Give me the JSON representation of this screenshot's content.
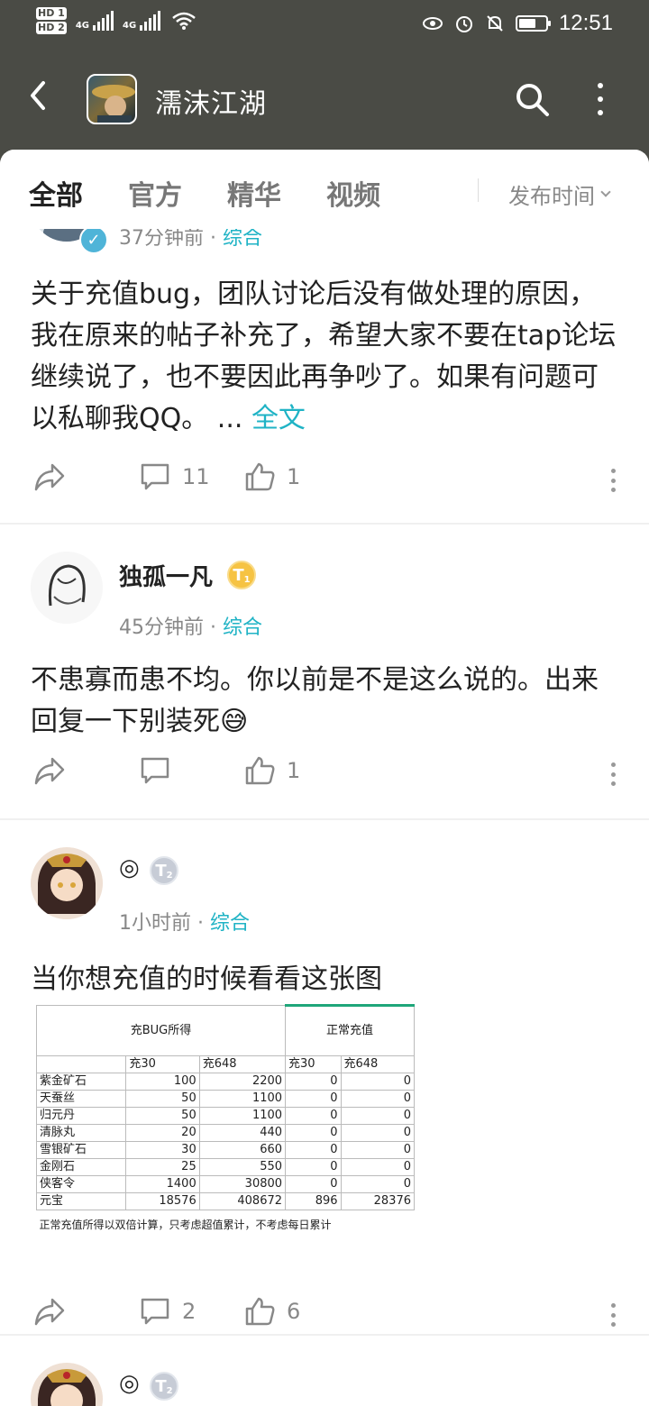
{
  "status": {
    "hd1": "HD 1",
    "hd2": "HD 2",
    "net1": "4G",
    "net2": "4G",
    "time": "12:51"
  },
  "header": {
    "title": "濡沫江湖"
  },
  "tabs": [
    "全部",
    "官方",
    "精华",
    "视频"
  ],
  "sort_label": "发布时间",
  "colors": {
    "accent": "#1fb3c5",
    "header_bg": "#4a4b45"
  },
  "posts": [
    {
      "meta_time": "37分钟前",
      "category": "综合",
      "body": "关于充值bug，团队讨论后没有做处理的原因，我在原来的帖子补充了，希望大家不要在tap论坛继续说了，也不要因此再争吵了。如果有问题可以私聊我QQ。",
      "ellipsis": "...",
      "more": "全文",
      "comments": "11",
      "likes": "1"
    },
    {
      "author": "独孤一凡",
      "badge": "T",
      "badge_level": "1",
      "meta_time": "45分钟前",
      "category": "综合",
      "body": "不患寡而患不均。你以前是不是这么说的。出来回复一下别装死😅",
      "comments": "",
      "likes": "1"
    },
    {
      "author": "◎",
      "badge": "T",
      "badge_level": "2",
      "meta_time": "1小时前",
      "category": "综合",
      "body": "当你想充值的时候看看这张图",
      "comments": "2",
      "likes": "6",
      "table": {
        "group_bug": "充BUG所得",
        "group_normal": "正常充值",
        "sub_headers": [
          "充30",
          "充648",
          "充30",
          "充648"
        ],
        "rows": [
          [
            "紫金矿石",
            "100",
            "2200",
            "0",
            "0"
          ],
          [
            "天蚕丝",
            "50",
            "1100",
            "0",
            "0"
          ],
          [
            "归元丹",
            "50",
            "1100",
            "0",
            "0"
          ],
          [
            "清脉丸",
            "20",
            "440",
            "0",
            "0"
          ],
          [
            "雪银矿石",
            "30",
            "660",
            "0",
            "0"
          ],
          [
            "金刚石",
            "25",
            "550",
            "0",
            "0"
          ],
          [
            "侠客令",
            "1400",
            "30800",
            "0",
            "0"
          ],
          [
            "元宝",
            "18576",
            "408672",
            "896",
            "28376"
          ]
        ],
        "note": "正常充值所得以双倍计算，只考虑超值累计，不考虑每日累计"
      }
    },
    {
      "author": "◎",
      "badge": "T",
      "badge_level": "2"
    }
  ]
}
